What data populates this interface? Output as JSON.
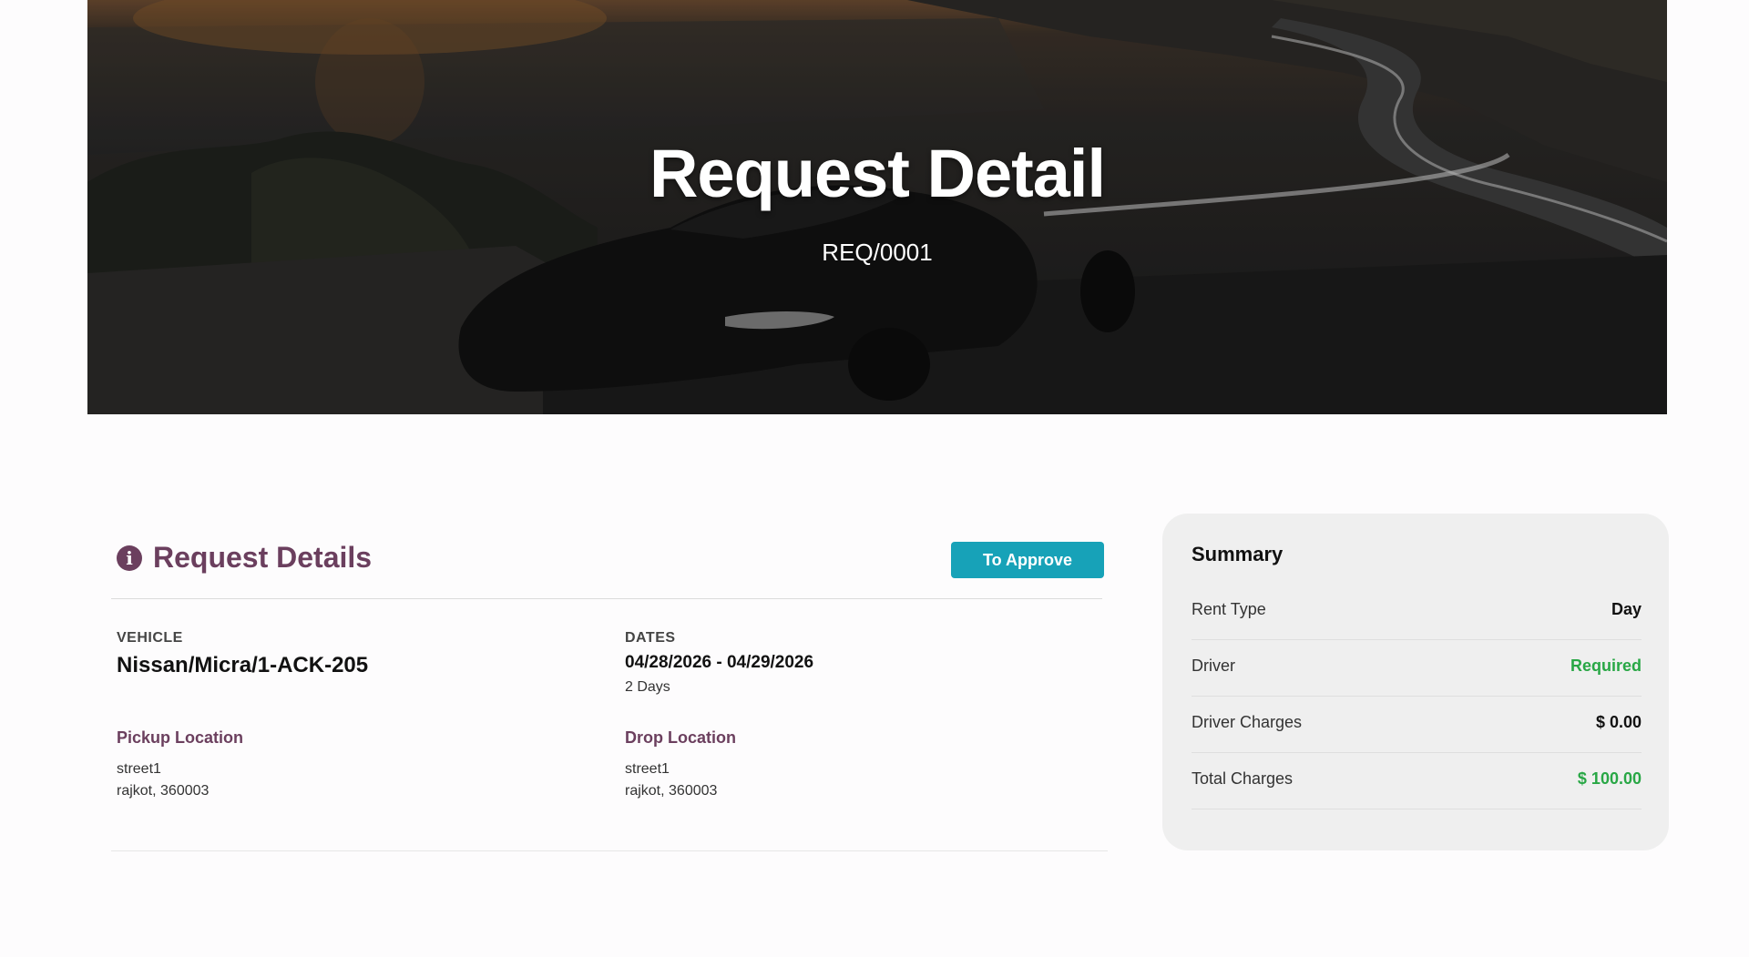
{
  "hero": {
    "title": "Request Detail",
    "reference": "REQ/0001"
  },
  "details": {
    "title": "Request Details",
    "status_label": "To Approve",
    "vehicle_label": "VEHICLE",
    "vehicle_value": "Nissan/Micra/1-ACK-205",
    "dates_label": "DATES",
    "dates_value": "04/28/2026 - 04/29/2026",
    "duration": "2 Days",
    "pickup": {
      "label": "Pickup Location",
      "street": "street1",
      "city_zip": "rajkot, 360003"
    },
    "drop": {
      "label": "Drop Location",
      "street": "street1",
      "city_zip": "rajkot, 360003"
    }
  },
  "summary": {
    "title": "Summary",
    "rows": [
      {
        "key": "Rent Type",
        "value": "Day"
      },
      {
        "key": "Driver",
        "value": "Required"
      },
      {
        "key": "Driver Charges",
        "value": "$ 0.00"
      },
      {
        "key": "Total Charges",
        "value": "$ 100.00"
      }
    ]
  },
  "icons": {
    "details_icon": "info-circle-icon"
  },
  "colors": {
    "accent": "#6b3f5e",
    "status_button": "#17a2b8",
    "positive": "#28a745",
    "summary_bg": "#efefef"
  }
}
